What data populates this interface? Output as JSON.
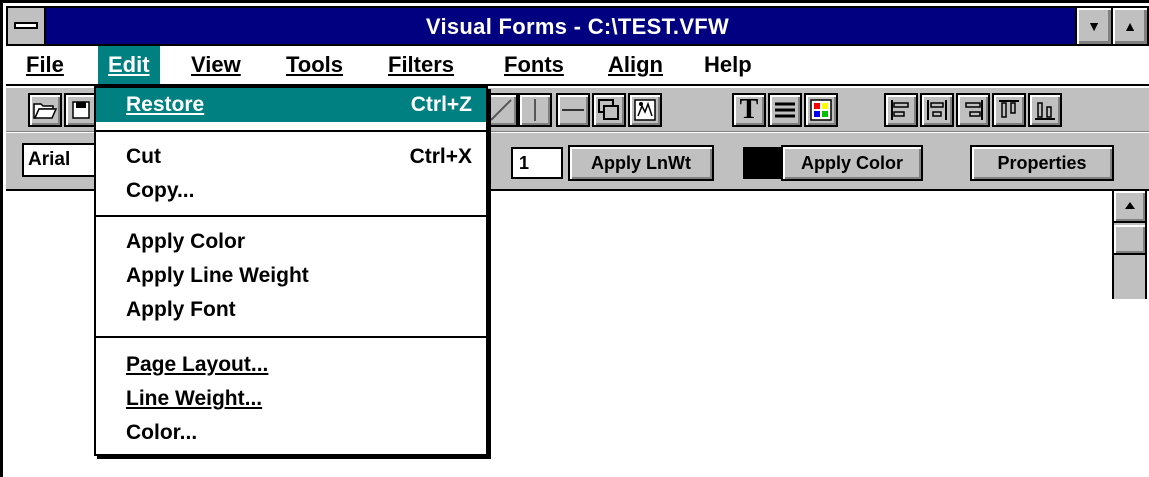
{
  "window": {
    "title": "Visual Forms - C:\\TEST.VFW"
  },
  "title_buttons": {
    "minimize": "▼",
    "maximize": "▲"
  },
  "menubar": {
    "items": [
      {
        "label": "File"
      },
      {
        "label": "Edit"
      },
      {
        "label": "View"
      },
      {
        "label": "Tools"
      },
      {
        "label": "Filters"
      },
      {
        "label": "Fonts"
      },
      {
        "label": "Align"
      },
      {
        "label": "Help"
      }
    ]
  },
  "toolbar": {
    "tools": [
      {
        "icon": "open-folder-icon"
      },
      {
        "icon": "save-icon"
      },
      {
        "icon": "diagonal-line-icon"
      },
      {
        "icon": "vertical-line-icon"
      },
      {
        "icon": "horizontal-line-icon"
      },
      {
        "icon": "rectangle-icon"
      },
      {
        "icon": "image-icon"
      },
      {
        "icon": "text-icon",
        "glyph": "T"
      },
      {
        "icon": "lines-icon"
      },
      {
        "icon": "color-grid-icon"
      },
      {
        "icon": "align-left-icon"
      },
      {
        "icon": "align-center-icon"
      },
      {
        "icon": "align-right-icon"
      },
      {
        "icon": "align-top-icon"
      },
      {
        "icon": "align-bottom-icon"
      }
    ]
  },
  "propbar": {
    "font_value": "Arial",
    "line_weight_value": "1",
    "apply_lnwt_label": "Apply LnWt",
    "current_color": "#000000",
    "apply_color_label": "Apply Color",
    "properties_label": "Properties"
  },
  "edit_menu": {
    "items": [
      {
        "label": "Restore",
        "accel": "Ctrl+Z",
        "highlighted": true
      },
      {
        "label": "Cut",
        "accel": "Ctrl+X"
      },
      {
        "label": "Copy..."
      },
      {
        "label": "Apply Color"
      },
      {
        "label": "Apply Line Weight"
      },
      {
        "label": "Apply Font"
      },
      {
        "label": "Page Layout..."
      },
      {
        "label": "Line Weight..."
      },
      {
        "label": "Color..."
      }
    ]
  },
  "colors": {
    "title_bar": "#000080",
    "highlight": "#008080",
    "face": "#c0c0c0"
  }
}
